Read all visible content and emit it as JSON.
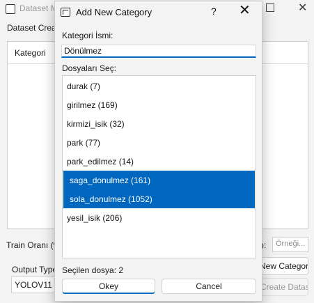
{
  "main_window": {
    "title": "Dataset M",
    "dataset_create_label": "Dataset Creat",
    "table_header_category": "Kategori",
    "train_ratio_label": "Train Oranı (%",
    "train_ratio_suffix": "):",
    "example_input_placeholder": "Örneği...",
    "output_type_label": "Output Type",
    "output_type_value": "YOLOV11",
    "add_category_button": "New Category",
    "create_dataset_button": "Create Dataset"
  },
  "dialog": {
    "title": "Add New Category",
    "help_label": "?",
    "close_label": "✕",
    "category_name_label": "Kategori İsmi:",
    "category_name_value": "Dönülmez",
    "select_files_label": "Dosyaları Seç:",
    "files": [
      {
        "label": "durak (7)",
        "selected": false
      },
      {
        "label": "girilmez (169)",
        "selected": false
      },
      {
        "label": "kirmizi_isik (32)",
        "selected": false
      },
      {
        "label": "park (77)",
        "selected": false
      },
      {
        "label": "park_edilmez (14)",
        "selected": false
      },
      {
        "label": "saga_donulmez (161)",
        "selected": true
      },
      {
        "label": "sola_donulmez (1052)",
        "selected": true
      },
      {
        "label": "yesil_isik (206)",
        "selected": false
      }
    ],
    "selected_count_text": "Seçilen dosya: 2",
    "ok_button": "Okey",
    "cancel_button": "Cancel"
  },
  "colors": {
    "accent": "#0067c0",
    "selection_bg": "#0067c0",
    "selection_text": "#ffffff"
  }
}
